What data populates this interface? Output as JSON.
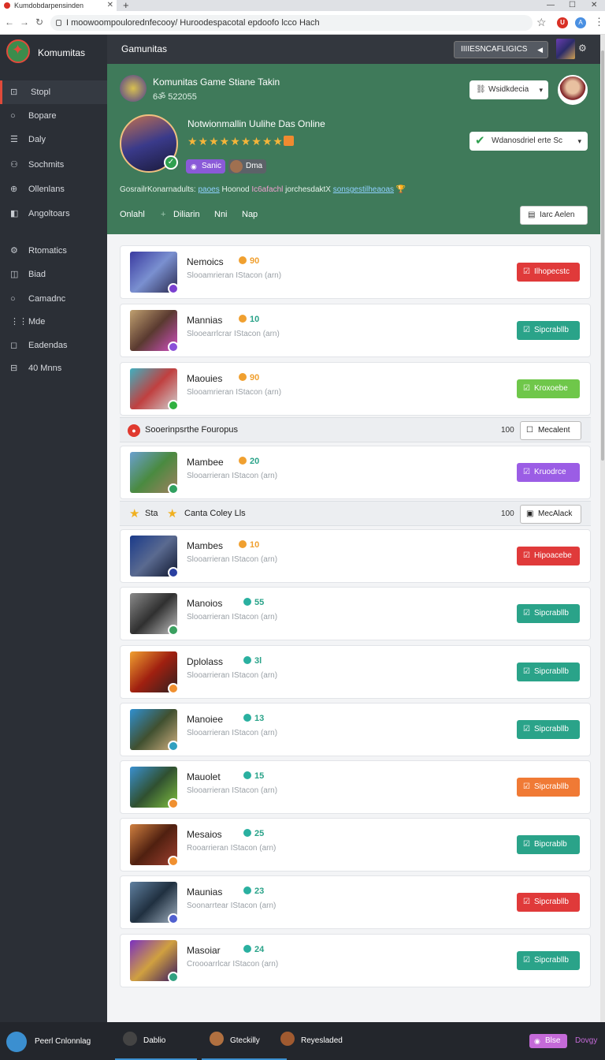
{
  "browser": {
    "tab_title": "Kumdobdarpensinden",
    "url": "I moowoompoulorednfecooy/ Huroodespacotal epdoofo lcco Hach",
    "ext1": "U",
    "ext2": "A"
  },
  "sidebar": {
    "brand": "Komumitas",
    "items": [
      {
        "icon": "⊡",
        "label": "Stopl"
      },
      {
        "icon": "○",
        "label": "Bopare"
      },
      {
        "icon": "☰",
        "label": "Daly"
      },
      {
        "icon": "⚇",
        "label": "Sochmits"
      },
      {
        "icon": "⊕",
        "label": "Ollenlans"
      },
      {
        "icon": "◧",
        "label": "Angoltoars"
      },
      {
        "icon": "⚙",
        "label": "Rtomatics"
      },
      {
        "icon": "◫",
        "label": "Biad"
      },
      {
        "icon": "○",
        "label": "Camadnc"
      },
      {
        "icon": "⋮⋮",
        "label": "Mde"
      },
      {
        "icon": "◻",
        "label": "Eadendas"
      },
      {
        "icon": "⊟",
        "label": "40 Mnns"
      }
    ]
  },
  "topbar": {
    "title": "Gamunitas",
    "filter": "IIIIESNCAFLIGICS"
  },
  "hero": {
    "game_title": "Komunitas Game Stiane Takin",
    "game_sub": "6ॐ 522055",
    "select1": "Wsidkdecia",
    "headline": "Notwionmallin Uulihe Das Online",
    "stars": "★★★★★★★★★",
    "chip1": "Sanic",
    "chip2": "Dma",
    "select2": "Wdanosdriel erte Sc",
    "desc_pre": "GosrailrKonarnadults:",
    "desc_link1": "paoes",
    "desc_mid": "Hoonod",
    "desc_hl": "Ic6afachl",
    "desc_mid2": "jorchesdaktX",
    "desc_link2": "sonsgestilheaoas",
    "tabs": [
      "Onlahl",
      "Diliarin",
      "Nni",
      "Nap"
    ],
    "add_button": "Iarc Aelen"
  },
  "cards": [
    {
      "name": "Nemoics",
      "score": "90",
      "sub": "Slooamrieran IStacon (arn)",
      "action": "Ilhopecstc"
    },
    {
      "name": "Mannias",
      "score": "10",
      "sub": "Slooearrlcrar IStacon (arn)",
      "action": "Sipcrabllb"
    },
    {
      "name": "Maouies",
      "score": "90",
      "sub": "Slooamrieran IStacon (arn)",
      "action": "Kroxoebe"
    },
    {
      "name": "Mambee",
      "score": "20",
      "sub": "Slooarrieran IStacon (arn)",
      "action": "Kruodrce"
    },
    {
      "name": "Mambes",
      "score": "10",
      "sub": "Slooarrieran IStacon (arn)",
      "action": "Hipoacebe"
    },
    {
      "name": "Manoios",
      "score": "55",
      "sub": "Slooarrieran IStacon (arn)",
      "action": "Sipcrabllb"
    },
    {
      "name": "Dplolass",
      "score": "3l",
      "sub": "Slooarrieran IStacon (arn)",
      "action": "Sipcrabllb"
    },
    {
      "name": "Manoiee",
      "score": "13",
      "sub": "Slooarrieran IStacon (arn)",
      "action": "Sipcrabllb"
    },
    {
      "name": "Mauolet",
      "score": "15",
      "sub": "Slooarrieran IStacon (arn)",
      "action": "Sipcrabllb"
    },
    {
      "name": "Mesaios",
      "score": "25",
      "sub": "Rooarrieran IStacon (arn)",
      "action": "Bipcrablb"
    },
    {
      "name": "Maunias",
      "score": "23",
      "sub": "Soonarrtear IStacon (arn)",
      "action": "Sipcrabllb"
    },
    {
      "name": "Masoiar",
      "score": "24",
      "sub": "Croooarrlcar IStacon (arn)",
      "action": "Sipcrabllb"
    }
  ],
  "sections": [
    {
      "title": "Sooerinpsrthe Fouropus",
      "count": "100",
      "button": "Mecalent"
    },
    {
      "star_label": "Sta",
      "title": "Canta Coley Lls",
      "count": "100",
      "button": "MecAlack"
    }
  ],
  "bottom": {
    "user": "Peerl Cnlonnlag",
    "tabs": [
      "Dablio",
      "Gteckilly",
      "Reyesladed"
    ],
    "pill": "Blse",
    "last": "Dovgy"
  },
  "colors": {
    "hero_bg": "#3f7a5a",
    "red": "#e03a3a",
    "teal": "#2aa389",
    "lime": "#6fc74a",
    "purple": "#9b5de5",
    "orange": "#f07a35"
  }
}
